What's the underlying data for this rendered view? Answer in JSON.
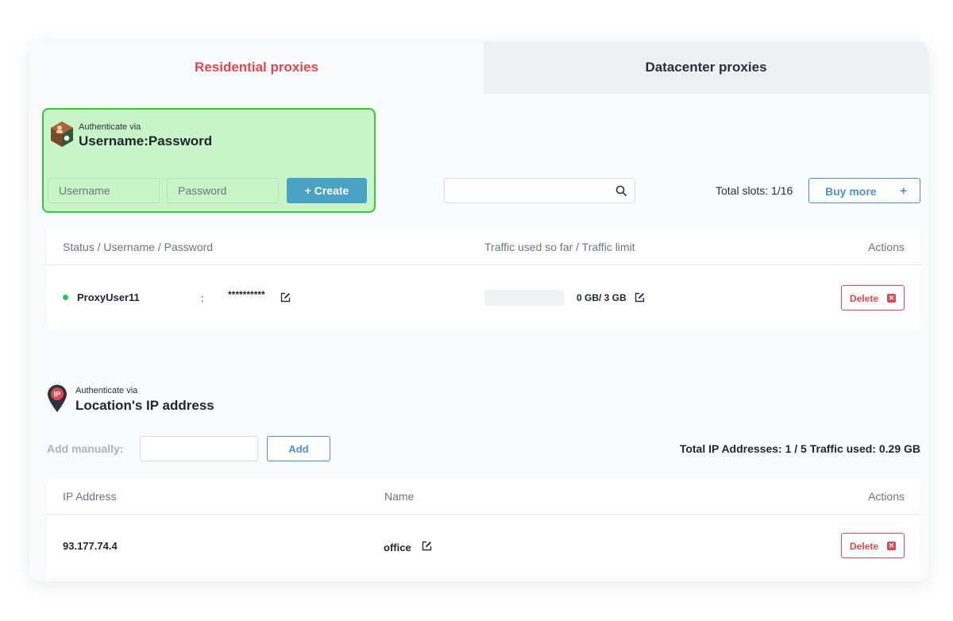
{
  "tabs": [
    {
      "label": "Residential proxies",
      "active": true
    },
    {
      "label": "Datacenter proxies",
      "active": false
    }
  ],
  "auth_userpass": {
    "caption": "Authenticate via",
    "method": "Username:Password",
    "username_placeholder": "Username",
    "password_placeholder": "Password",
    "create_label": "+ Create",
    "icon": "hexagon-user-key-icon"
  },
  "toolbar": {
    "search_value": "",
    "total_slots": "Total slots: 1/16",
    "buy_more_label": "Buy more",
    "buy_more_plus": "+"
  },
  "user_table": {
    "columns": {
      "status": "Status / Username / Password",
      "traffic": "Traffic used so far / Traffic limit",
      "actions": "Actions"
    },
    "rows": [
      {
        "status": "active",
        "username": "ProxyUser11",
        "separator": ":",
        "password": "**********",
        "traffic_fraction": 0,
        "traffic_text": "0 GB/ 3 GB",
        "delete_label": "Delete"
      }
    ]
  },
  "auth_ip": {
    "caption": "Authenticate via",
    "method": "Location's IP address",
    "add_label": "Add manually:",
    "ip_value": "",
    "add_button": "Add",
    "totals": "Total IP Addresses: 1 / 5  Traffic used: 0.29 GB",
    "icon": "map-pin-ip-icon"
  },
  "ip_table": {
    "columns": {
      "ip": "IP Address",
      "name": "Name",
      "actions": "Actions"
    },
    "rows": [
      {
        "ip": "93.177.74.4",
        "name": "office",
        "delete_label": "Delete"
      }
    ]
  },
  "colors": {
    "accent_red": "#e0474f",
    "accent_blue": "#4a90d9",
    "create_button": "#4aa3c4",
    "highlight_green": "#c8f5c8",
    "status_active": "#32c25b"
  }
}
